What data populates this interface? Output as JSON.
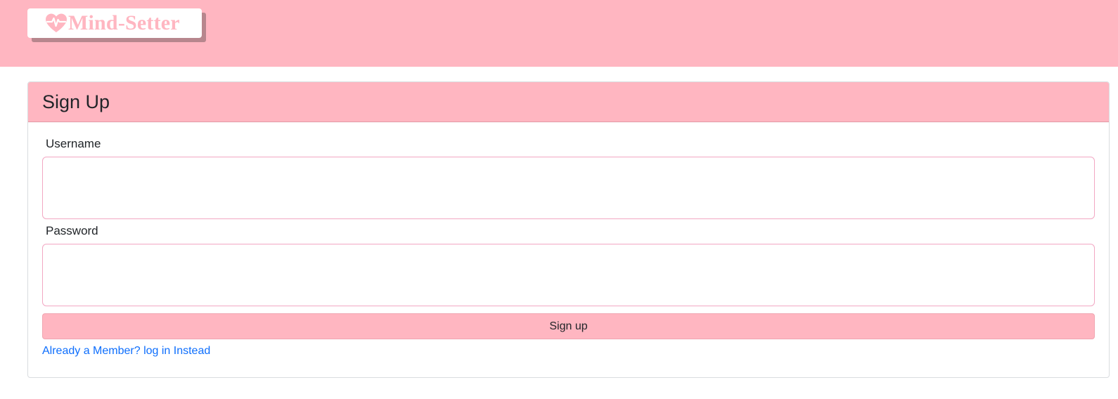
{
  "brand": {
    "name": "Mind-Setter",
    "icon": "heart-pulse-icon",
    "color": "#ffb6c1"
  },
  "theme": {
    "header_bg": "#ffb6c1",
    "link_color": "#0d6efd"
  },
  "signup": {
    "title": "Sign Up",
    "username_label": "Username",
    "username_value": "",
    "password_label": "Password",
    "password_value": "",
    "submit_label": "Sign up",
    "login_link": "Already a Member? log in Instead"
  }
}
